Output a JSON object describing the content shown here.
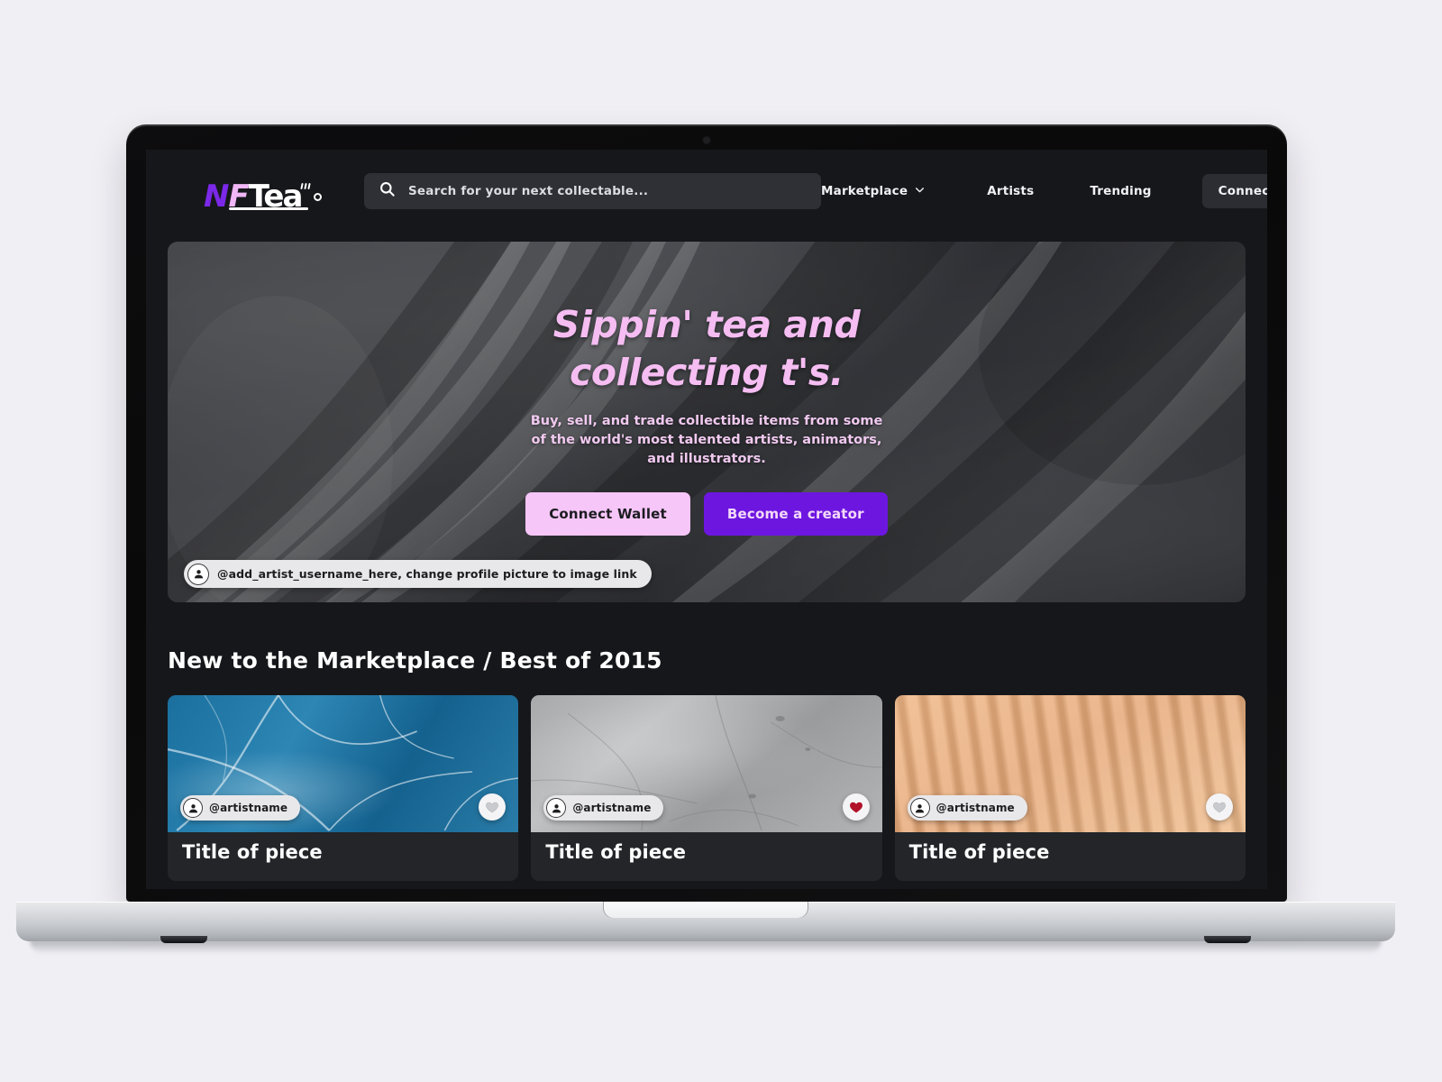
{
  "brand": {
    "logo_n": "N",
    "logo_f": "F",
    "logo_tea": "Tea",
    "accent_purple": "#7b28e8",
    "accent_pink": "#f0b6f5"
  },
  "nav": {
    "search_placeholder": "Search for your next collectable...",
    "search_value": "",
    "links": [
      {
        "label": "Marketplace",
        "has_dropdown": true
      },
      {
        "label": "Artists",
        "has_dropdown": false
      },
      {
        "label": "Trending",
        "has_dropdown": false
      }
    ],
    "connect_wallet_label": "Connect Wallet"
  },
  "hero": {
    "title": "Sippin' tea and collecting t's.",
    "subtitle": "Buy, sell, and trade collectible items from some of the world's most talented artists, animators, and illustrators.",
    "primary_button": "Connect Wallet",
    "secondary_button": "Become a creator",
    "artist_credit": "@add_artist_username_here, change profile picture to image link",
    "title_color": "#f5bdf2",
    "primary_button_color": "#f6c6f8",
    "secondary_button_color": "#6d16e0"
  },
  "section": {
    "title": "New to the Marketplace / Best of 2015"
  },
  "cards": [
    {
      "artist": "@artistname",
      "title": "Title of piece",
      "media": "ice",
      "liked": false
    },
    {
      "artist": "@artistname",
      "title": "Title of piece",
      "media": "stone",
      "liked": true
    },
    {
      "artist": "@artistname",
      "title": "Title of piece",
      "media": "sand",
      "liked": false
    }
  ],
  "colors": {
    "page_background": "#f0eff4",
    "site_background": "#16171b",
    "liked_heart": "#b2112a",
    "unliked_heart": "#c9cacd"
  }
}
